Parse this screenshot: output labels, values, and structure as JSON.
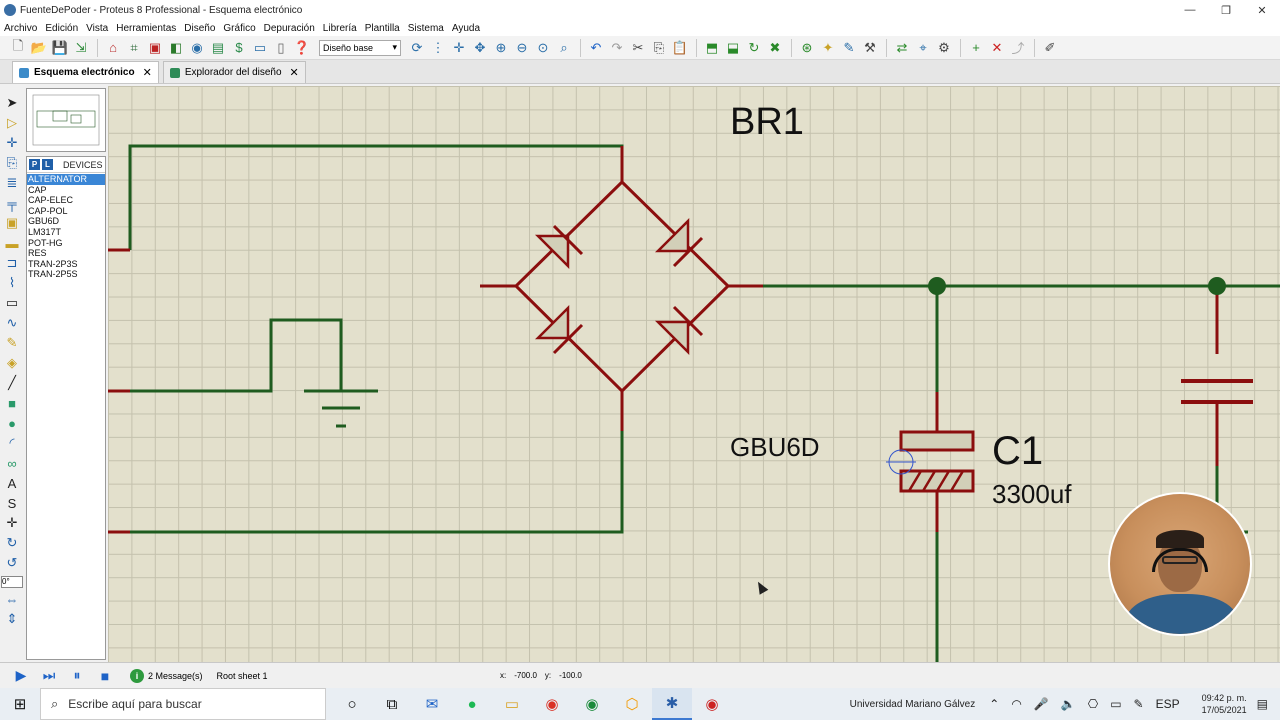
{
  "window": {
    "title": "FuenteDePoder - Proteus 8 Professional - Esquema electrónico",
    "controls": [
      "—",
      "❐",
      "✕"
    ]
  },
  "menu": [
    "Archivo",
    "Edición",
    "Vista",
    "Herramientas",
    "Diseño",
    "Gráfico",
    "Depuración",
    "Librería",
    "Plantilla",
    "Sistema",
    "Ayuda"
  ],
  "toolbar": {
    "layer_select": "Diseño base"
  },
  "tabs": [
    {
      "label": "Esquema electrónico",
      "active": true
    },
    {
      "label": "Explorador del diseño",
      "active": false
    }
  ],
  "left_toolbar": {
    "angle_value": "0°"
  },
  "devices": {
    "header_p": "P",
    "header_l": "L",
    "header_label": "DEVICES",
    "items": [
      "ALTERNATOR",
      "CAP",
      "CAP-ELEC",
      "CAP-POL",
      "GBU6D",
      "LM317T",
      "POT-HG",
      "RES",
      "TRAN-2P3S",
      "TRAN-2P5S"
    ],
    "selected": "ALTERNATOR"
  },
  "schematic": {
    "bridge_ref": "BR1",
    "bridge_part": "GBU6D",
    "cap_ref": "C1",
    "cap_value": "3300uf",
    "wire_color": "#1f5c1f",
    "pin_color": "#8b0e0e",
    "grid_color": "#e3e0cc"
  },
  "statusbar": {
    "messages": "2 Message(s)",
    "sheet": "Root sheet 1",
    "x_label": "x:",
    "x_value": "-700.0",
    "y_label": "y:",
    "y_value": "-100.0"
  },
  "taskbar": {
    "search_placeholder": "Escribe aquí para buscar",
    "pinned_label": "Universidad Mariano Gálvez",
    "lang": "ESP",
    "time": "09:42 p. m.",
    "date": "17/05/2021"
  }
}
